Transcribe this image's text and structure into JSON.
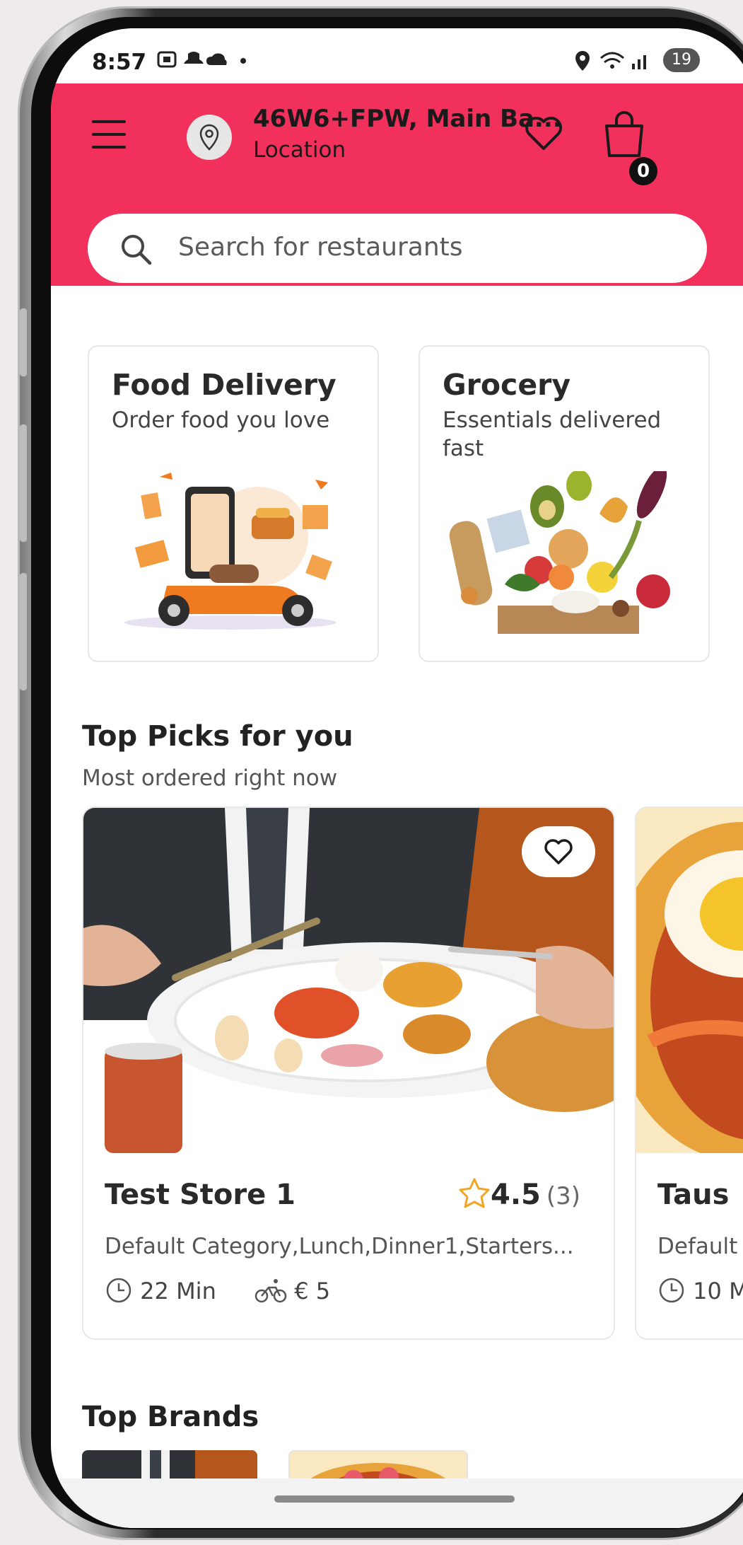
{
  "status_bar": {
    "time": "8:57",
    "battery": "19"
  },
  "header": {
    "location_title": "46W6+FPW, Main Ba...",
    "location_sub": "Location",
    "cart_count": "0",
    "search_placeholder": "Search for restaurants",
    "accent_color": "#f2305c"
  },
  "categories": [
    {
      "title": "Food Delivery",
      "subtitle": "Order food you love"
    },
    {
      "title": "Grocery",
      "subtitle": "Essentials delivered fast"
    }
  ],
  "top_picks": {
    "title": "Top Picks for you",
    "subtitle": "Most ordered right now",
    "stores": [
      {
        "name": "Test Store 1",
        "rating": "4.5",
        "rating_count": "(3)",
        "categories": "Default Category,Lunch,Dinner1,Starters...",
        "time": "22 Min",
        "delivery_fee": "€ 5"
      },
      {
        "name": "Taus",
        "categories": "Default",
        "time": "10 M"
      }
    ]
  },
  "top_brands": {
    "title": "Top Brands"
  }
}
